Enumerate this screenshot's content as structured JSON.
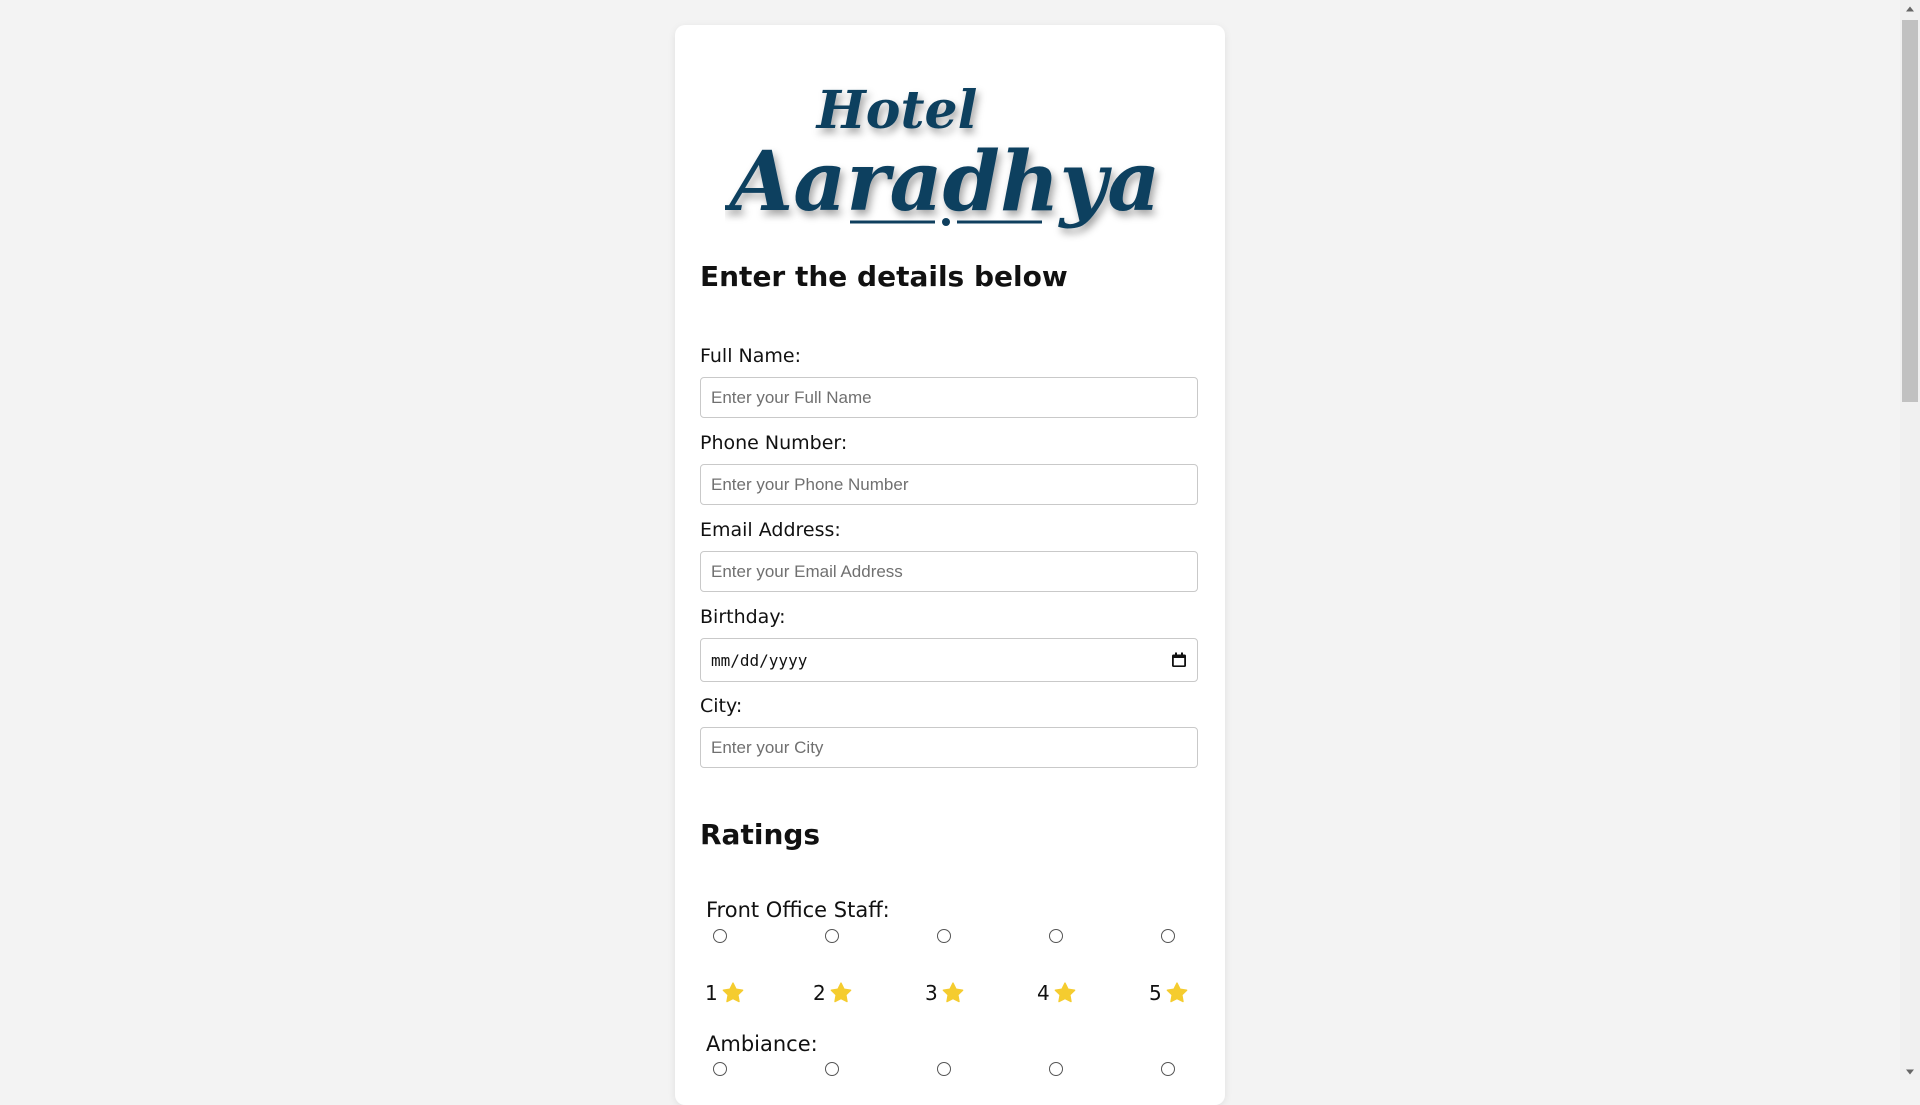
{
  "brand": {
    "logo_top": "Hotel",
    "logo_main": "Aaradhya",
    "color": "#0f3f5e"
  },
  "form": {
    "heading": "Enter the details below",
    "fields": [
      {
        "label": "Full Name:",
        "placeholder": "Enter your Full Name"
      },
      {
        "label": "Phone Number:",
        "placeholder": "Enter your Phone Number"
      },
      {
        "label": "Email Address:",
        "placeholder": "Enter your Email Address"
      },
      {
        "label": "Birthday:",
        "value": "mm/dd/yyyy"
      },
      {
        "label": "City:",
        "placeholder": "Enter your City"
      }
    ]
  },
  "ratings": {
    "heading": "Ratings",
    "categories": [
      {
        "label": "Front Office Staff:",
        "options": [
          "1",
          "2",
          "3",
          "4",
          "5"
        ]
      },
      {
        "label": "Ambiance:"
      }
    ],
    "star_color": "#f5cc2f"
  },
  "icons": {
    "date": "calendar-icon",
    "rating": "star-icon"
  }
}
